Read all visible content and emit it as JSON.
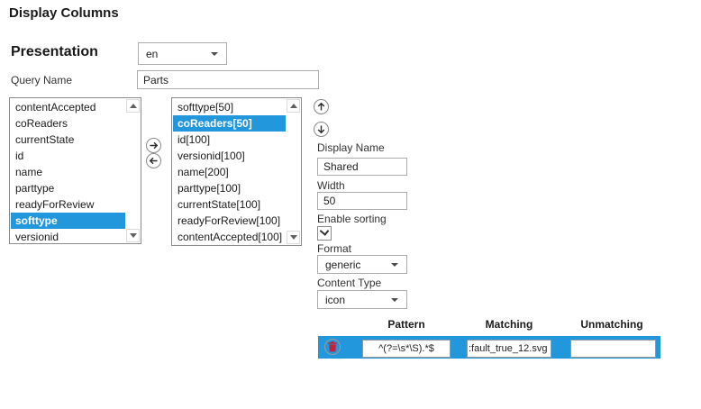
{
  "title": "Display Columns",
  "presentation": {
    "label": "Presentation",
    "value": "en"
  },
  "query_name": {
    "label": "Query Name",
    "value": "Parts"
  },
  "lists": {
    "available": {
      "selected_index": 7,
      "items": [
        "contentAccepted",
        "coReaders",
        "currentState",
        "id",
        "name",
        "parttype",
        "readyForReview",
        "softtype",
        "versionid"
      ]
    },
    "selected": {
      "selected_index": 1,
      "items": [
        "softtype[50]",
        "coReaders[50]",
        "id[100]",
        "versionid[100]",
        "name[200]",
        "parttype[100]",
        "currentState[100]",
        "readyForReview[100]",
        "contentAccepted[100]"
      ]
    }
  },
  "properties": {
    "display_name_label": "Display Name",
    "display_name_value": "Shared",
    "width_label": "Width",
    "width_value": "50",
    "enable_sorting_label": "Enable sorting",
    "enable_sorting_checked": true,
    "format_label": "Format",
    "format_value": "generic",
    "content_type_label": "Content Type",
    "content_type_value": "icon"
  },
  "pattern_table": {
    "headers": {
      "pattern": "Pattern",
      "matching": "Matching",
      "unmatching": "Unmatching"
    },
    "row": {
      "pattern": "^(?=\\s*\\S).*$",
      "matching": ":fault_true_12.svg",
      "unmatching": ""
    }
  },
  "icons": {
    "move-right-icon": "circled right arrow",
    "move-left-icon": "circled left arrow",
    "move-up-icon": "circled up arrow",
    "move-down-icon": "circled down arrow",
    "delete-row-icon": "red trash can in circle",
    "dropdown-arrow-icon": "▼",
    "scroll-up-icon": "▲",
    "scroll-down-icon": "▼",
    "checkmark-icon": "✓"
  },
  "colors": {
    "selection_blue": "#2397dc",
    "table_row_blue": "#2397dc",
    "trash_red": "#c0243c"
  }
}
